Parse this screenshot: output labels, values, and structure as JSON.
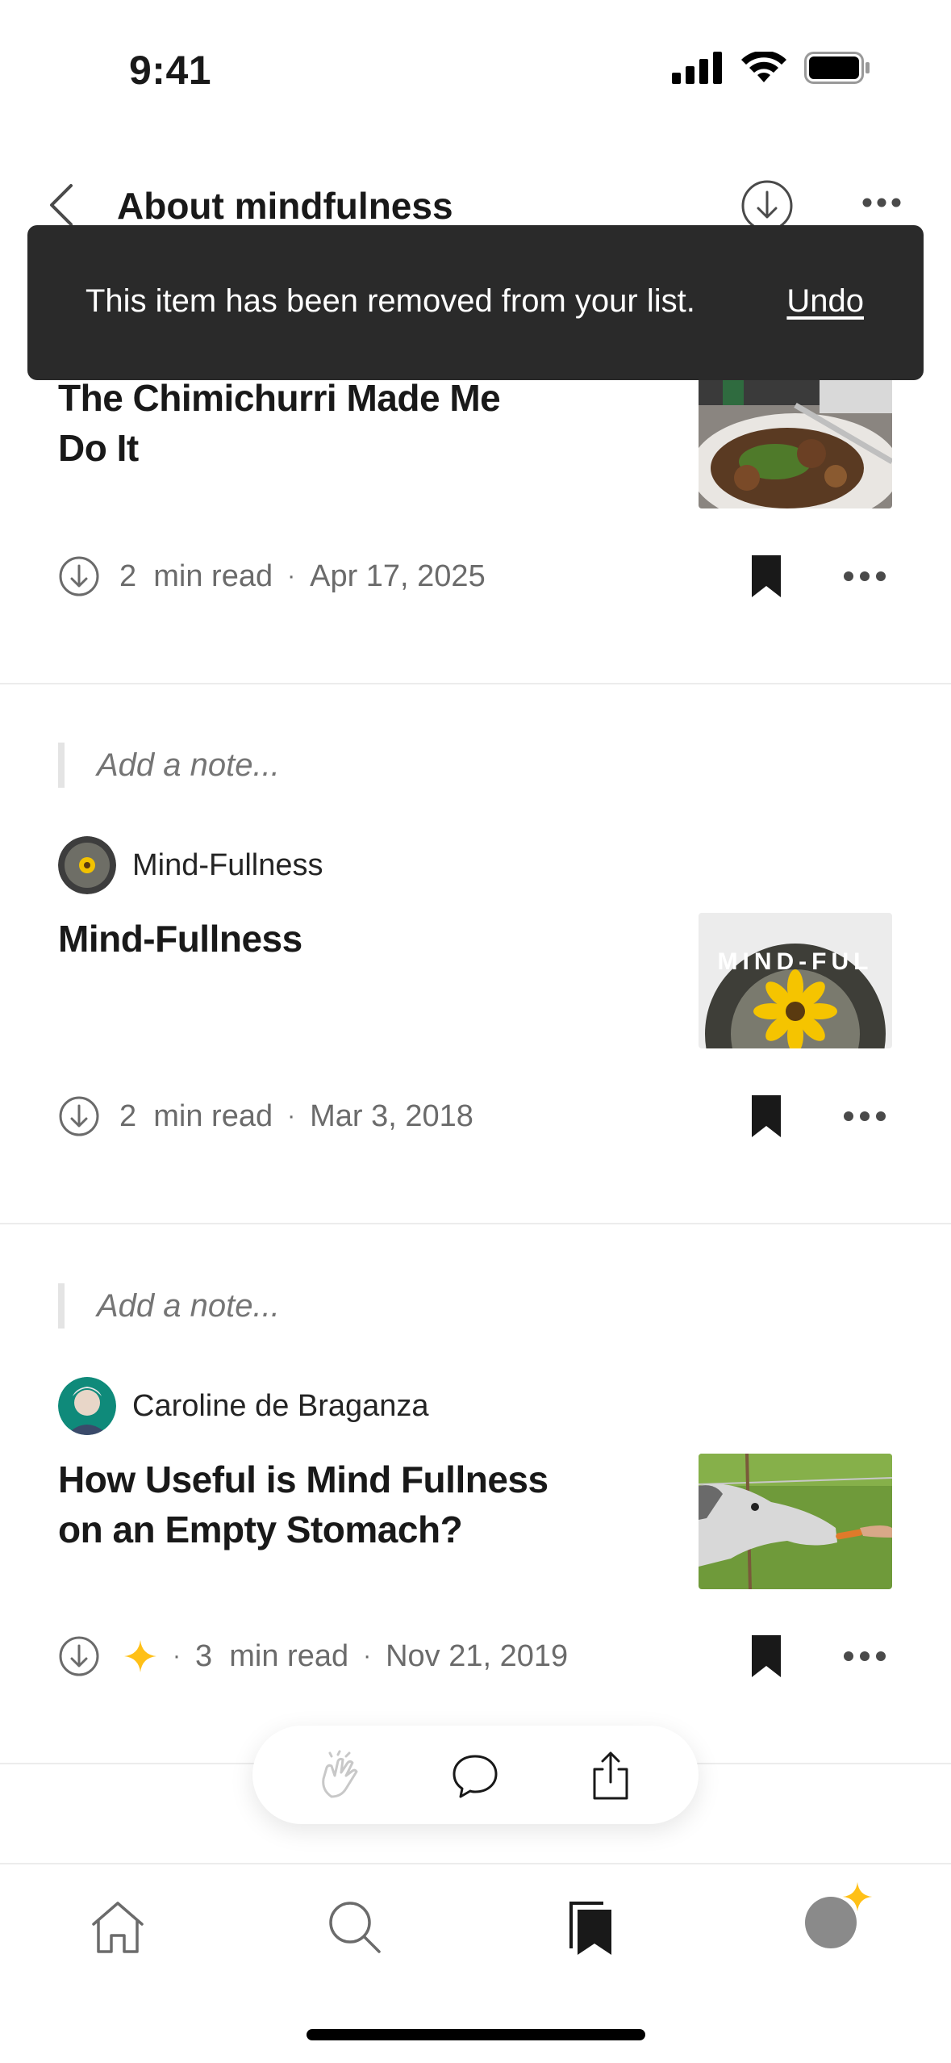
{
  "status_bar": {
    "time": "9:41"
  },
  "header": {
    "title": "About mindfulness"
  },
  "toast": {
    "message": "This item has been removed from your list.",
    "undo_label": "Undo"
  },
  "articles": [
    {
      "title_line1": "The Chimichurri Made Me",
      "title_line2": "Do It",
      "read_time": "2  min read",
      "date": "Apr 17, 2025",
      "thumbnail": "food-plate-image"
    },
    {
      "note_placeholder": "Add a note...",
      "author": "Mind-Fullness",
      "title_line1": "Mind-Fullness",
      "read_time": "2  min read",
      "date": "Mar 3, 2018",
      "thumbnail": "mind-fullness-sunflower-image",
      "thumb_text": "MIND-FUL"
    },
    {
      "note_placeholder": "Add a note...",
      "author": "Caroline de Braganza",
      "title_line1": "How Useful is Mind Fullness",
      "title_line2": "on an Empty Stomach?",
      "read_time": "3  min read",
      "date": "Nov 21, 2019",
      "member_only": true,
      "thumbnail": "horse-eating-carrot-image"
    }
  ],
  "colors": {
    "toast_bg": "#2a2a2a",
    "star": "#FFC017",
    "text": "#191919",
    "meta": "#6b6b6b"
  },
  "icons": {
    "floating_bar": [
      "clap-icon",
      "comment-icon",
      "share-icon"
    ],
    "bottom_nav": [
      "home-icon",
      "search-icon",
      "library-icon",
      "profile-avatar"
    ]
  }
}
